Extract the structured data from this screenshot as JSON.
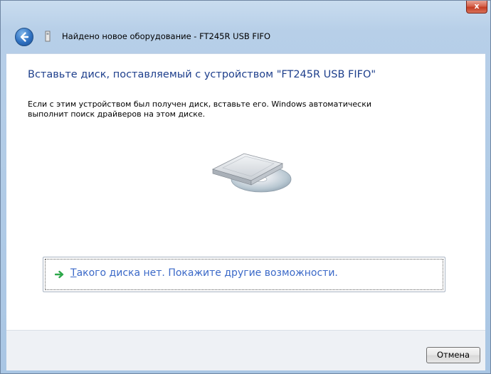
{
  "window": {
    "title": "Найдено новое оборудование - FT245R USB FIFO",
    "close_label": "x"
  },
  "content": {
    "heading": "Вставьте диск, поставляемый с устройством \"FT245R USB FIFO\"",
    "description_line1": "Если с этим устройством был получен диск, вставьте его.  Windows автоматически",
    "description_line2": "выполнит поиск драйверов на этом диске."
  },
  "option": {
    "label_first": "Т",
    "label_rest": "акого диска нет. Покажите другие возможности."
  },
  "footer": {
    "cancel_label": "Отмена"
  },
  "colors": {
    "heading": "#1e3f8c",
    "option_link": "#3b69c8",
    "option_arrow": "#2ea84a"
  },
  "icons": [
    "back-arrow-icon",
    "device-icon",
    "disc-drive-icon",
    "green-arrow-icon",
    "close-icon"
  ]
}
